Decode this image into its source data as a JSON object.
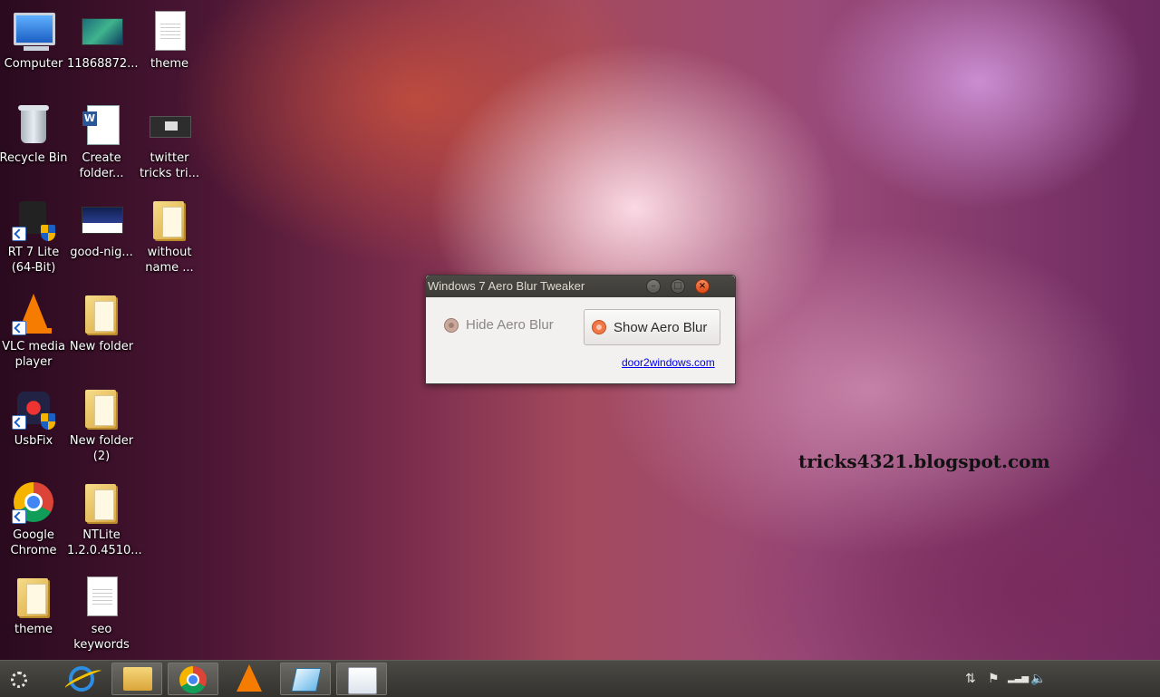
{
  "desktop": {
    "icons": [
      {
        "label": "Computer"
      },
      {
        "label": "11868872..."
      },
      {
        "label": "theme"
      },
      {
        "label": "Recycle Bin"
      },
      {
        "label": "Create folder..."
      },
      {
        "label": "twitter tricks tri..."
      },
      {
        "label": "RT 7 Lite (64-Bit)"
      },
      {
        "label": "good-nig..."
      },
      {
        "label": "without name ..."
      },
      {
        "label": "VLC media player"
      },
      {
        "label": "New folder"
      },
      {
        "label": "UsbFix"
      },
      {
        "label": "New folder (2)"
      },
      {
        "label": "Google Chrome"
      },
      {
        "label": "NTLite 1.2.0.4510..."
      },
      {
        "label": "theme"
      },
      {
        "label": "seo keywords"
      }
    ],
    "watermark": "tricks4321.blogspot.com"
  },
  "dialog": {
    "title": "Windows 7 Aero Blur Tweaker",
    "hide_label": "Hide Aero Blur",
    "show_label": "Show Aero Blur",
    "link": "door2windows.com",
    "selected": "Show Aero Blur",
    "close_glyph": "×",
    "min_glyph": "–",
    "max_glyph": "□"
  },
  "taskbar": {
    "items": [
      "start-icon",
      "internet-explorer-icon",
      "file-explorer-icon",
      "chrome-icon",
      "vlc-icon",
      "glass-app-icon",
      "blank-window-icon"
    ],
    "tray": [
      "network-icon",
      "flag-icon",
      "signal-icon",
      "volume-icon"
    ],
    "tray_glyphs": {
      "network": "⇅",
      "flag": "⚑",
      "signal": "▂▃▅",
      "volume": "🔈"
    }
  },
  "colors": {
    "accent": "#dd4814",
    "title_bar": "#3c3b37",
    "link": "#0000ee"
  }
}
